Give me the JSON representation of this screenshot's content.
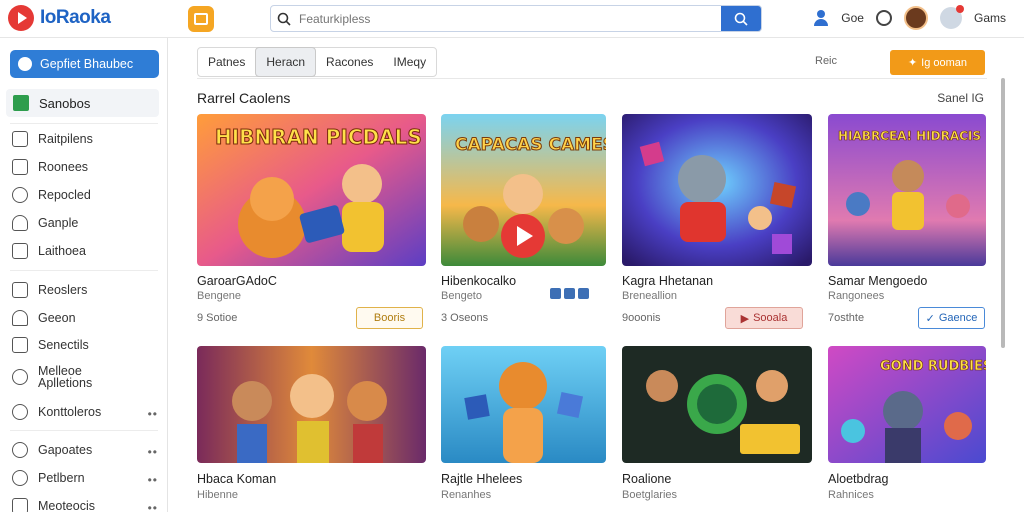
{
  "app": {
    "logo_text": "IoRaoka"
  },
  "search": {
    "placeholder": "Featurkipless"
  },
  "header": {
    "link1": "Goe",
    "link2": "Gams"
  },
  "sidebar": {
    "primary_label": "Gepfiet Bhaubec",
    "active_label": "Sanobos",
    "items": [
      {
        "label": "Raitpilens"
      },
      {
        "label": "Roonees"
      },
      {
        "label": "Repocled"
      },
      {
        "label": "Ganple"
      },
      {
        "label": "Laithoea"
      },
      {
        "label": "Reoslers"
      },
      {
        "label": "Geeon"
      },
      {
        "label": "Senectils"
      },
      {
        "label": "Melleoe Aplletions"
      },
      {
        "label": "Konttoleros"
      },
      {
        "label": "Gapoates"
      },
      {
        "label": "Petlbern"
      },
      {
        "label": "Meoteocis"
      }
    ]
  },
  "tabs": [
    "Patnes",
    "Heracn",
    "Racones",
    "IMeqy"
  ],
  "toolbar": {
    "link": "Reic",
    "orange_button": "Ig ooman"
  },
  "section": {
    "title": "Rarrel Caolens",
    "more_link": "Sanel IG"
  },
  "cards": [
    {
      "art_text": "HIBNRAN PICDALS",
      "title": "GaroarGAdoC",
      "sub": "Bengene",
      "meta": "9 Sotioe",
      "button": "Booris"
    },
    {
      "art_text": "CAPACAS CAMES",
      "title": "Hibenkocalko",
      "sub": "Bengeto",
      "meta": "3 Oseons"
    },
    {
      "title": "Kagra Hhetanan",
      "sub": "Breneallion",
      "meta": "9ooonis",
      "button": "Sooala"
    },
    {
      "art_text": "HIABRCEA! HIDRACIS",
      "title": "Samar Mengoedo",
      "sub": "Rangonees",
      "meta": "7osthte",
      "button": "Gaence"
    },
    {
      "title": "Hbaca Koman",
      "sub": "Hibenne"
    },
    {
      "title": "Rajtle Hhelees",
      "sub": "Renanhes"
    },
    {
      "title": "Roalione",
      "sub": "Boetglaries"
    },
    {
      "art_text": "GOND RUDBIES",
      "title": "Aloetbdrag",
      "sub": "Rahnices"
    }
  ],
  "colors": {
    "accent": "#2f7dd6",
    "orange": "#f29a18",
    "logo_red": "#e53935",
    "green": "#2e9d4d"
  }
}
